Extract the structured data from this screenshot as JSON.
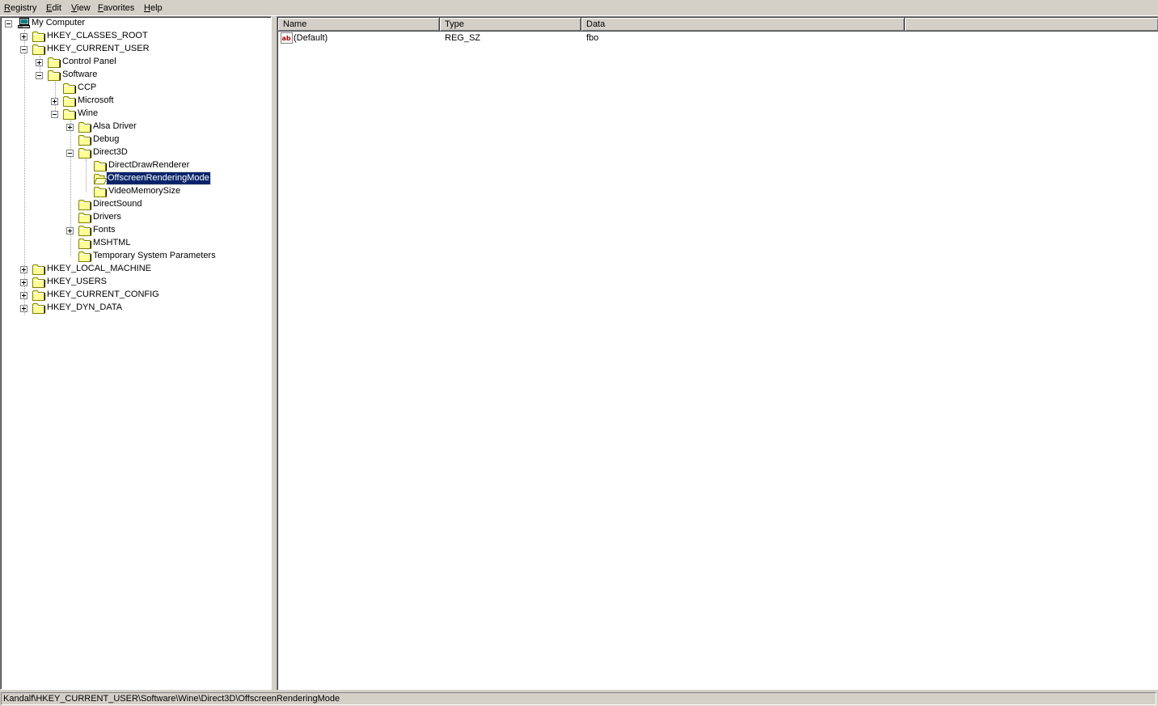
{
  "menu": {
    "registry": {
      "label": "Registry",
      "accel": "R",
      "rest": "egistry"
    },
    "edit": {
      "label": "Edit",
      "accel": "E",
      "rest": "dit"
    },
    "view": {
      "label": "View",
      "accel": "V",
      "rest": "iew"
    },
    "favorites": {
      "label": "Favorites",
      "accel": "F",
      "rest": "avorites"
    },
    "help": {
      "label": "Help",
      "accel": "H",
      "rest": "elp"
    }
  },
  "tree": {
    "nodes": [
      {
        "label": "My Computer",
        "icon": "computer-icon",
        "expanded": true
      },
      {
        "label": "HKEY_CLASSES_ROOT",
        "icon": "folder-icon",
        "expanded": false
      },
      {
        "label": "HKEY_CURRENT_USER",
        "icon": "folder-icon",
        "expanded": true
      },
      {
        "label": "Control Panel",
        "icon": "folder-icon",
        "expanded": false
      },
      {
        "label": "Software",
        "icon": "folder-icon",
        "expanded": true
      },
      {
        "label": "CCP",
        "icon": "folder-icon"
      },
      {
        "label": "Microsoft",
        "icon": "folder-icon",
        "expanded": false
      },
      {
        "label": "Wine",
        "icon": "folder-icon",
        "expanded": true
      },
      {
        "label": "Alsa Driver",
        "icon": "folder-icon",
        "expanded": false
      },
      {
        "label": "Debug",
        "icon": "folder-icon"
      },
      {
        "label": "Direct3D",
        "icon": "folder-icon",
        "expanded": true
      },
      {
        "label": "DirectDrawRenderer",
        "icon": "folder-icon"
      },
      {
        "label": "OffscreenRenderingMode",
        "icon": "open-folder-icon",
        "selected": true
      },
      {
        "label": "VideoMemorySize",
        "icon": "folder-icon"
      },
      {
        "label": "DirectSound",
        "icon": "folder-icon"
      },
      {
        "label": "Drivers",
        "icon": "folder-icon"
      },
      {
        "label": "Fonts",
        "icon": "folder-icon",
        "expanded": false
      },
      {
        "label": "MSHTML",
        "icon": "folder-icon"
      },
      {
        "label": "Temporary System Parameters",
        "icon": "folder-icon"
      },
      {
        "label": "HKEY_LOCAL_MACHINE",
        "icon": "folder-icon",
        "expanded": false
      },
      {
        "label": "HKEY_USERS",
        "icon": "folder-icon",
        "expanded": false
      },
      {
        "label": "HKEY_CURRENT_CONFIG",
        "icon": "folder-icon",
        "expanded": false
      },
      {
        "label": "HKEY_DYN_DATA",
        "icon": "folder-icon",
        "expanded": false
      }
    ]
  },
  "list": {
    "columns": [
      "Name",
      "Type",
      "Data"
    ],
    "rows": [
      {
        "name": "(Default)",
        "type": "REG_SZ",
        "data": "fbo",
        "icon": "string-value-icon"
      }
    ]
  },
  "status": {
    "path": "Kandalf\\HKEY_CURRENT_USER\\Software\\Wine\\Direct3D\\OffscreenRenderingMode"
  },
  "colors": {
    "window_bg": "#d4d0c8",
    "selection_bg": "#0a246a",
    "folder_yellow": "#ffff99"
  }
}
